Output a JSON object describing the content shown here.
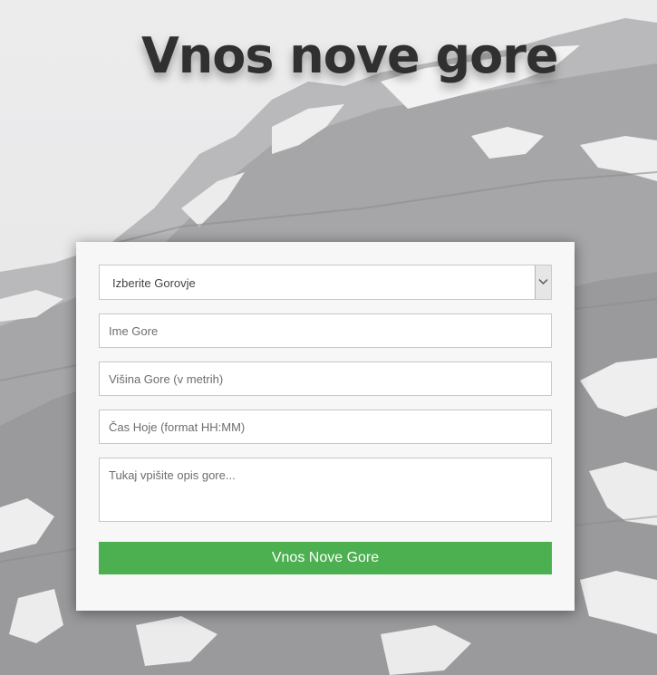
{
  "page": {
    "title": "Vnos nove gore"
  },
  "form": {
    "gorovje_select": {
      "selected": "Izberite Gorovje"
    },
    "ime_gore": {
      "placeholder": "Ime Gore"
    },
    "visina_gore": {
      "placeholder": "Višina Gore (v metrih)"
    },
    "cas_hoje": {
      "placeholder": "Čas Hoje (format HH:MM)"
    },
    "opis": {
      "placeholder": "Tukaj vpišite opis gore..."
    },
    "submit_label": "Vnos Nove Gore"
  },
  "colors": {
    "accent": "#4caf50",
    "title": "#303030",
    "card": "#f7f7f7"
  },
  "icons": {
    "select_arrow": "chevron-down-icon"
  }
}
